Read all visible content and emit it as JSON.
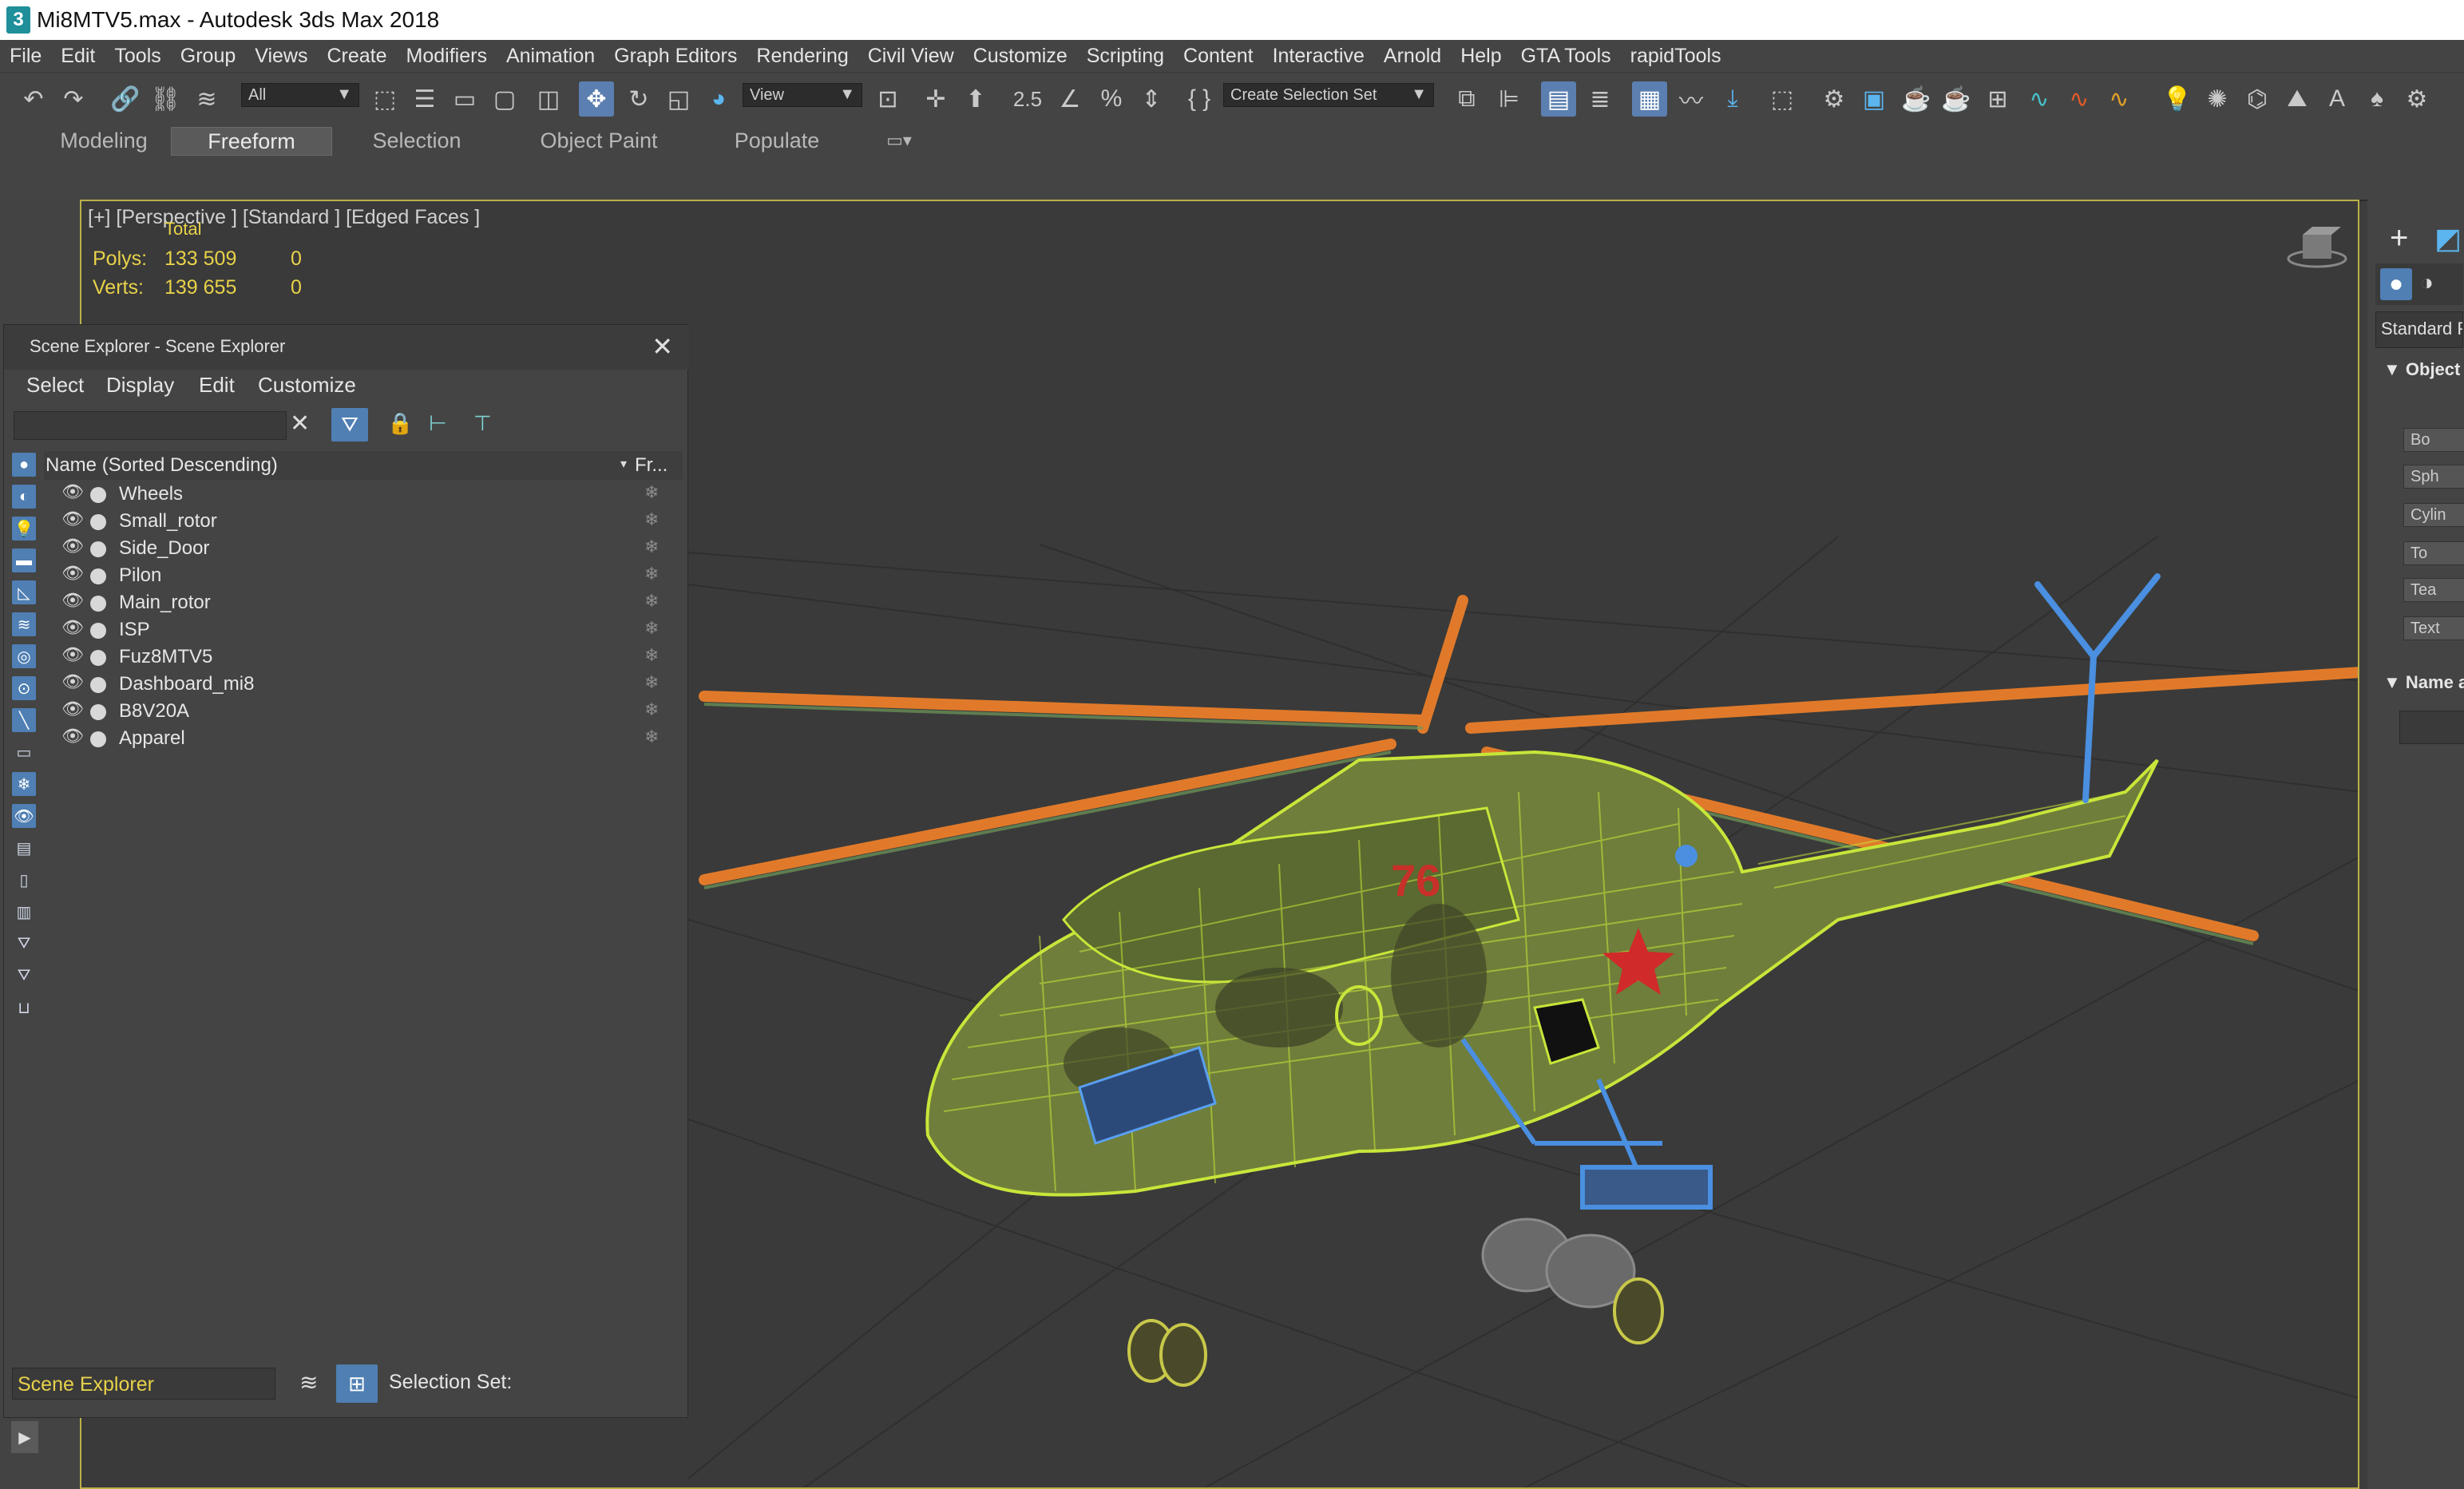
{
  "window": {
    "title": "Mi8MTV5.max - Autodesk 3ds Max 2018",
    "app_icon": "3"
  },
  "menu": [
    "File",
    "Edit",
    "Tools",
    "Group",
    "Views",
    "Create",
    "Modifiers",
    "Animation",
    "Graph Editors",
    "Rendering",
    "Civil View",
    "Customize",
    "Scripting",
    "Content",
    "Interactive",
    "Arnold",
    "Help",
    "GTA Tools",
    "rapidTools"
  ],
  "toolbar": {
    "filter_value": "All",
    "view_value": "View",
    "selection_set_placeholder": "Create Selection Set",
    "snap_label": "2.5"
  },
  "ribbon_tabs": [
    "Modeling",
    "Freeform",
    "Selection",
    "Object Paint",
    "Populate"
  ],
  "ribbon_active": "Freeform",
  "viewport": {
    "label": "[+] [Perspective ]  [Standard ]  [Edged Faces ]",
    "stats_header": "Total",
    "polys_label": "Polys:",
    "polys_total": "133 509",
    "polys_sel": "0",
    "verts_label": "Verts:",
    "verts_total": "139 655",
    "verts_sel": "0",
    "nose_number": "76"
  },
  "scene_explorer": {
    "title": "Scene Explorer - Scene Explorer",
    "menu": [
      "Select",
      "Display",
      "Edit",
      "Customize"
    ],
    "column_name": "Name (Sorted Descending)",
    "column_frozen": "Fr...",
    "items": [
      "Wheels",
      "Small_rotor",
      "Side_Door",
      "Pilon",
      "Main_rotor",
      "ISP",
      "Fuz8MTV5",
      "Dashboard_mi8",
      "B8V20A",
      "Apparel"
    ],
    "footer_name": "Scene Explorer",
    "footer_selection_set": "Selection Set:"
  },
  "command_panel": {
    "dropdown": "Standard P",
    "rollout_object": "Object",
    "rollout_name": "Name a",
    "buttons": [
      "Bo",
      "Sph",
      "Cylin",
      "To",
      "Tea",
      "Text"
    ]
  },
  "colors": {
    "accent": "#5b7fb0",
    "wire": "#c8e63a",
    "rotor": "#e07a2a",
    "selected": "#4a8fe0",
    "stats": "#e8d24a"
  }
}
